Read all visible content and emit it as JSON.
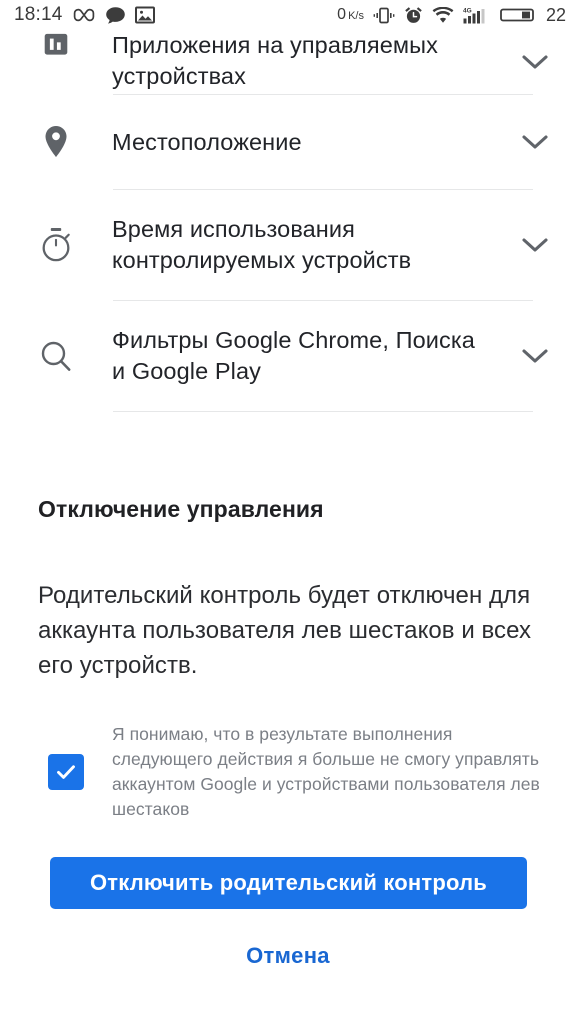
{
  "status_bar": {
    "time": "18:14",
    "left_icons": [
      "infinity-icon",
      "chat-bubble-icon",
      "photo-icon"
    ],
    "network_speed": "0",
    "network_speed_unit": "K/s",
    "right_icons": [
      "vibrate-icon",
      "alarm-clock-icon",
      "wifi-icon",
      "cellular-signal-icon"
    ],
    "network_type": "4G",
    "battery_percent": "22"
  },
  "list": {
    "items": [
      {
        "icon": "bar-chart-icon",
        "label": "Приложения на управляемых устройствах",
        "expander": "chevron-down-icon"
      },
      {
        "icon": "location-pin-icon",
        "label": "Местоположение",
        "expander": "chevron-down-icon"
      },
      {
        "icon": "stopwatch-icon",
        "label": "Время использования контролируемых устройств",
        "expander": "chevron-down-icon"
      },
      {
        "icon": "search-icon",
        "label": "Фильтры Google Chrome, Поиска и Google Play",
        "expander": "chevron-down-icon"
      }
    ]
  },
  "section": {
    "title": "Отключение управления",
    "body": "Родительский контроль будет отключен для аккаунта пользователя лев шестаков и всех его устройств."
  },
  "consent": {
    "checked": true,
    "text": "Я понимаю, что в результате выполнения следующего действия я больше не смогу управлять аккаунтом Google и устройствами пользователя лев шестаков"
  },
  "actions": {
    "primary_label": "Отключить родительский контроль",
    "cancel_label": "Отмена"
  },
  "colors": {
    "accent": "#1a73e8",
    "link": "#1967d2",
    "text_primary": "#202124",
    "text_secondary": "#7b7f86",
    "icon": "#5f6368",
    "divider": "#e6e7e8"
  }
}
